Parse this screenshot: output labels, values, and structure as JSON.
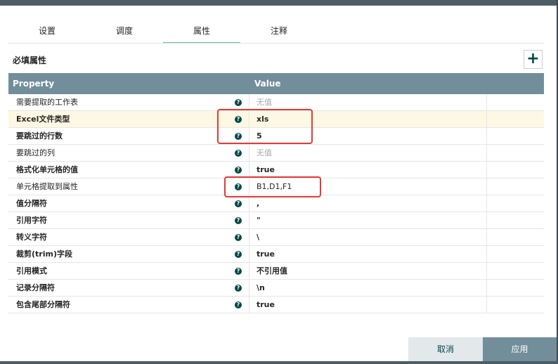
{
  "tabs": [
    {
      "label": "设置",
      "active": false
    },
    {
      "label": "调度",
      "active": false
    },
    {
      "label": "属性",
      "active": true
    },
    {
      "label": "注释",
      "active": false
    }
  ],
  "section": {
    "title": "必填属性",
    "add_label": "+"
  },
  "grid": {
    "columns": {
      "property": "Property",
      "value": "Value"
    },
    "rows": [
      {
        "name": "需要提取的工作表",
        "value": "无值",
        "help": "?"
      },
      {
        "name": "Excel文件类型",
        "value": "xls",
        "help": "?"
      },
      {
        "name": "要跳过的行数",
        "value": "5",
        "help": "?"
      },
      {
        "name": "要跳过的列",
        "value": "无值",
        "help": "?"
      },
      {
        "name": "格式化单元格的值",
        "value": "true",
        "help": "?"
      },
      {
        "name": "单元格提取到属性",
        "value": "B1,D1,F1",
        "help": "?"
      },
      {
        "name": "值分隔符",
        "value": ",",
        "help": "?"
      },
      {
        "name": "引用字符",
        "value": "\"",
        "help": "?"
      },
      {
        "name": "转义字符",
        "value": "\\",
        "help": "?"
      },
      {
        "name": "裁剪(trim)字段",
        "value": "true",
        "help": "?"
      },
      {
        "name": "引用模式",
        "value": "不引用值",
        "help": "?"
      },
      {
        "name": "记录分隔符",
        "value": "\\n",
        "help": "?"
      },
      {
        "name": "包含尾部分隔符",
        "value": "true",
        "help": "?"
      }
    ]
  },
  "footer": {
    "cancel": "取消",
    "apply": "应用"
  },
  "colors": {
    "accent": "#5ec2a3",
    "header": "#728e9b",
    "highlight_row": "#fdf8e3",
    "annotation_box": "#e53935"
  }
}
